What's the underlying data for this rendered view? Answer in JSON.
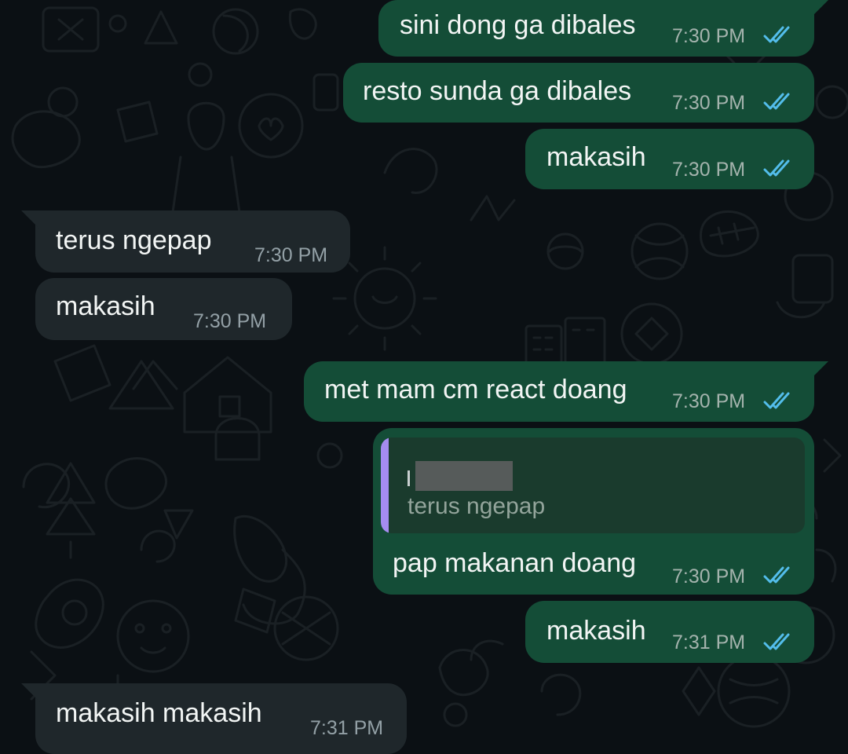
{
  "messages": [
    {
      "direction": "outgoing",
      "text": "sini dong ga dibales",
      "time": "7:30 PM",
      "status": "read"
    },
    {
      "direction": "outgoing",
      "text": "resto sunda ga dibales",
      "time": "7:30 PM",
      "status": "read"
    },
    {
      "direction": "outgoing",
      "text": "makasih",
      "time": "7:30 PM",
      "status": "read"
    },
    {
      "direction": "incoming",
      "text": "terus ngepap",
      "time": "7:30 PM"
    },
    {
      "direction": "incoming",
      "text": "makasih",
      "time": "7:30 PM"
    },
    {
      "direction": "outgoing",
      "text": "met mam cm react doang",
      "time": "7:30 PM",
      "status": "read"
    },
    {
      "direction": "outgoing",
      "text": "pap makanan doang",
      "time": "7:30 PM",
      "status": "read",
      "reply_to": {
        "text": "terus ngepap"
      }
    },
    {
      "direction": "outgoing",
      "text": "makasih",
      "time": "7:31 PM",
      "status": "read"
    },
    {
      "direction": "incoming",
      "text": "makasih makasih",
      "time": "7:31 PM"
    }
  ],
  "colors": {
    "background": "#0b1014",
    "outgoing_bubble": "#144d37",
    "incoming_bubble": "#1f272b",
    "read_ticks": "#53bdeb",
    "quote_accent": "#a58cf0"
  },
  "icons": {
    "read_status": "double-check-icon"
  }
}
